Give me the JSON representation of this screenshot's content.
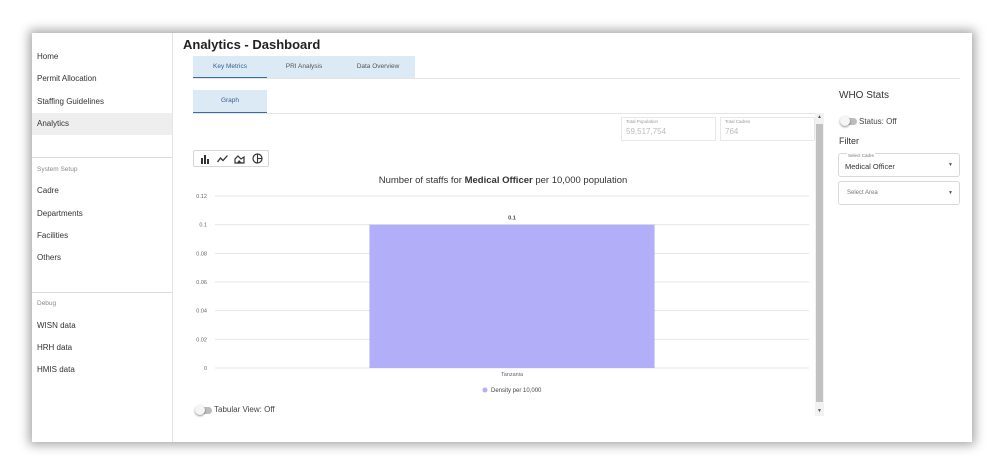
{
  "sidebar": {
    "items": [
      {
        "label": "Home"
      },
      {
        "label": "Permit Allocation"
      },
      {
        "label": "Staffing Guidelines"
      },
      {
        "label": "Analytics",
        "active": true
      }
    ],
    "system_setup": {
      "header": "System Setup",
      "items": [
        {
          "label": "Cadre"
        },
        {
          "label": "Departments"
        },
        {
          "label": "Facilities"
        },
        {
          "label": "Others"
        }
      ]
    },
    "debug": {
      "header": "Debug",
      "items": [
        {
          "label": "WISN data"
        },
        {
          "label": "HRH data"
        },
        {
          "label": "HMIS data"
        }
      ]
    }
  },
  "header": {
    "title": "Analytics - Dashboard"
  },
  "tabs": [
    {
      "label": "Key Metrics",
      "active": true
    },
    {
      "label": "PRI Analysis"
    },
    {
      "label": "Data Overview"
    }
  ],
  "subtabs": [
    {
      "label": "Graph",
      "active": true
    }
  ],
  "stats": {
    "population_label": "Total Population",
    "population_value": "59,517,754",
    "cadres_label": "Total Cadres",
    "cadres_value": "764"
  },
  "chart_toolbar": {
    "icons": [
      "bar-chart-icon",
      "line-chart-icon",
      "area-chart-icon",
      "pie-chart-icon"
    ]
  },
  "chart_data": {
    "type": "bar",
    "title_prefix": "Number of staffs for ",
    "title_bold": "Medical Officer",
    "title_suffix": " per 10,000 population",
    "categories": [
      "Tanzania"
    ],
    "series": [
      {
        "name": "Density per 10,000",
        "values": [
          0.1
        ],
        "color": "#b3aef8"
      }
    ],
    "data_labels": [
      "0.1"
    ],
    "yticks": [
      "0",
      "0.02",
      "0.04",
      "0.06",
      "0.08",
      "0.1",
      "0.12"
    ],
    "ylim": [
      0,
      0.12
    ],
    "grid": true,
    "legend_position": "bottom"
  },
  "tabular_view": {
    "label": "Tabular View: Off",
    "on": false
  },
  "right_panel": {
    "title": "WHO Stats",
    "status_label": "Status: Off",
    "filter_title": "Filter",
    "cadre_select": {
      "label": "Select Cadre",
      "value": "Medical Officer"
    },
    "area_select": {
      "placeholder": "Select Area"
    }
  },
  "colors": {
    "accent": "#3a6aa8",
    "tab_bg": "#dceaf6",
    "bar": "#b3aef8"
  }
}
